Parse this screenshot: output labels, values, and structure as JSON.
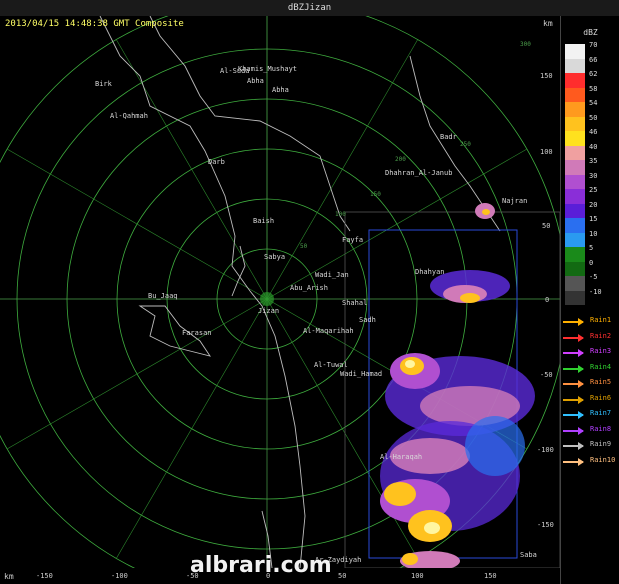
{
  "window": {
    "title": "dBZJizan"
  },
  "header": {
    "timestamp": "2013/04/15 14:48:38 GMT Composite",
    "km_label": "km"
  },
  "footer": {
    "km_label": "km",
    "watermark": "albrari.com"
  },
  "axis": {
    "x_ticks": [
      "-150",
      "-100",
      "-50",
      "0",
      "50",
      "100",
      "150"
    ],
    "y_ticks": [
      "150",
      "100",
      "50",
      "0",
      "-50",
      "-100",
      "-150"
    ]
  },
  "ring_labels": [
    "50",
    "100",
    "150",
    "200",
    "250",
    "300"
  ],
  "cities": [
    {
      "name": "Khamis_Mushayt"
    },
    {
      "name": "Al-Suda"
    },
    {
      "name": "Abha"
    },
    {
      "name": "Abha"
    },
    {
      "name": "Birk"
    },
    {
      "name": "Al-Qahmah"
    },
    {
      "name": "Darb"
    },
    {
      "name": "Badr"
    },
    {
      "name": "Dhahran_Al-Janub"
    },
    {
      "name": "Najran"
    },
    {
      "name": "Baish"
    },
    {
      "name": "Fayfa"
    },
    {
      "name": "Sabya"
    },
    {
      "name": "Wadi_Jan"
    },
    {
      "name": "Abu_Arish"
    },
    {
      "name": "Bu_Jaaq"
    },
    {
      "name": "Jizan"
    },
    {
      "name": "Dhahyan"
    },
    {
      "name": "Shahal"
    },
    {
      "name": "Sadh"
    },
    {
      "name": "Farasan"
    },
    {
      "name": "Al-Maqarihah"
    },
    {
      "name": "Al-Tuwal"
    },
    {
      "name": "Wadi_Hamad"
    },
    {
      "name": "Al-Haraqah"
    },
    {
      "name": "Ar_Zaydiyah"
    },
    {
      "name": "Saba"
    }
  ],
  "legend": {
    "title": "dBZ",
    "scale": [
      {
        "label": "70",
        "color": "#f2f2f2"
      },
      {
        "label": "66",
        "color": "#d9d9d9"
      },
      {
        "label": "62",
        "color": "#ff2d2d"
      },
      {
        "label": "58",
        "color": "#ff5a1e"
      },
      {
        "label": "54",
        "color": "#ff9a1e"
      },
      {
        "label": "50",
        "color": "#ffc21e"
      },
      {
        "label": "46",
        "color": "#ffe11e"
      },
      {
        "label": "40",
        "color": "#f0a0a0"
      },
      {
        "label": "35",
        "color": "#d07ab8"
      },
      {
        "label": "30",
        "color": "#b04fd0"
      },
      {
        "label": "25",
        "color": "#8a2ed8"
      },
      {
        "label": "20",
        "color": "#5a1ed8"
      },
      {
        "label": "15",
        "color": "#2a6ff0"
      },
      {
        "label": "10",
        "color": "#2a9af0"
      },
      {
        "label": "5",
        "color": "#1a8a1a"
      },
      {
        "label": "0",
        "color": "#126a12"
      },
      {
        "label": "-5",
        "color": "#555555"
      },
      {
        "label": "-10",
        "color": "#333333"
      }
    ],
    "rains": [
      {
        "label": "Rain1",
        "color": "#ffb000"
      },
      {
        "label": "Rain2",
        "color": "#ff3030"
      },
      {
        "label": "Rain3",
        "color": "#d040ff"
      },
      {
        "label": "Rain4",
        "color": "#30d030"
      },
      {
        "label": "Rain5",
        "color": "#ff9040"
      },
      {
        "label": "Rain6",
        "color": "#e0a000"
      },
      {
        "label": "Rain7",
        "color": "#30c0ff"
      },
      {
        "label": "Rain8",
        "color": "#b040ff"
      },
      {
        "label": "Rain9",
        "color": "#c0c0c0"
      },
      {
        "label": "Rain10",
        "color": "#ffc080"
      }
    ]
  }
}
